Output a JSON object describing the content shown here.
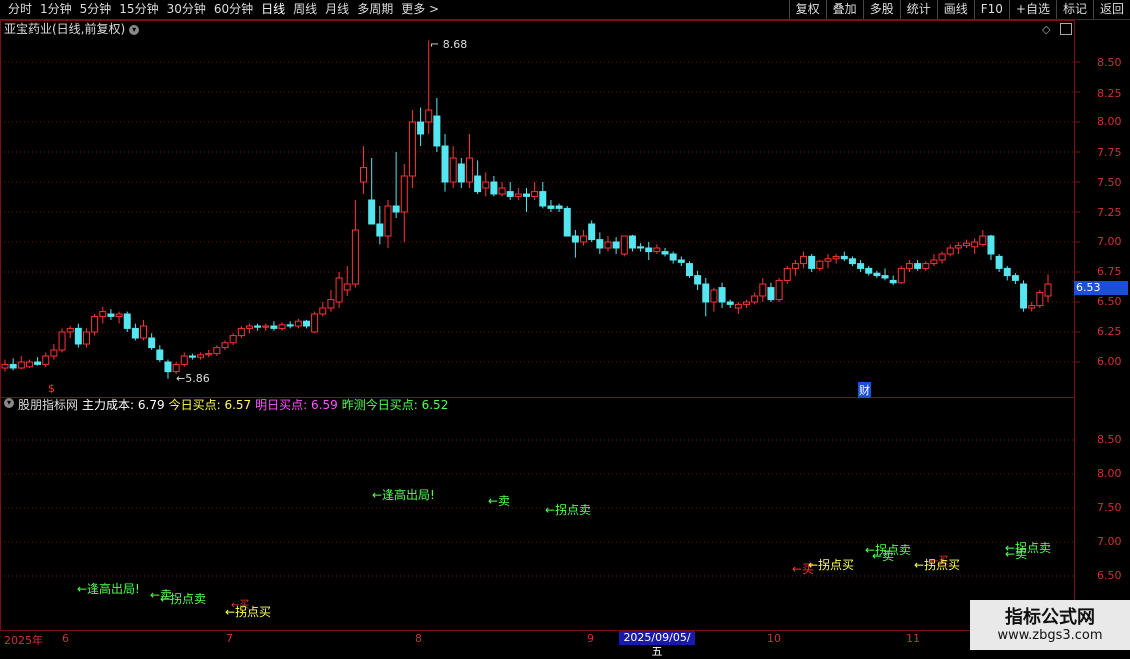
{
  "toolbar": {
    "periods": [
      "分时",
      "1分钟",
      "5分钟",
      "15分钟",
      "30分钟",
      "60分钟",
      "日线",
      "周线",
      "月线",
      "多周期",
      "更多 >"
    ],
    "active_period": "日线",
    "buttons": [
      "复权",
      "叠加",
      "多股",
      "统计",
      "画线",
      "F10",
      "+自选",
      "标记",
      "返回"
    ]
  },
  "main": {
    "title": "亚宝药业(日线,前复权)",
    "icons": [
      "diamond-icon",
      "restore-icon"
    ],
    "price_axis": [
      "8.50",
      "8.25",
      "8.00",
      "7.75",
      "7.50",
      "7.25",
      "7.00",
      "6.75",
      "6.50",
      "6.25",
      "6.00"
    ],
    "current_price": "6.53",
    "high_label": "8.68",
    "low_label": "5.86",
    "marker_dollar": "$",
    "marker_cai": "财"
  },
  "sub": {
    "name": "股朋指标网",
    "items": [
      {
        "label": "主力成本: 6.79",
        "color": "#ffffff"
      },
      {
        "label": "今日买点: 6.57",
        "color": "#ffff55"
      },
      {
        "label": "明日买点: 6.59",
        "color": "#ff55ff"
      },
      {
        "label": "昨测今日买点: 6.52",
        "color": "#55ff55"
      }
    ],
    "axis": [
      "8.50",
      "8.00",
      "7.50",
      "7.00",
      "6.50"
    ],
    "signals": [
      {
        "text": "←逢高出局!",
        "color": "#55ff55"
      },
      {
        "text": "←卖",
        "color": "#55ff55"
      },
      {
        "text": "←拐点卖",
        "color": "#55ff55"
      },
      {
        "text": "←逢高出局!",
        "color": "#55ff55"
      },
      {
        "text": "←卖",
        "color": "#55ff55"
      },
      {
        "text": "←拐点卖",
        "color": "#55ff55"
      },
      {
        "text": "←买",
        "color": "#ff3333"
      },
      {
        "text": "←拐点买",
        "color": "#ffff55"
      },
      {
        "text": "←买",
        "color": "#ff3333"
      },
      {
        "text": "←拐点买",
        "color": "#ffff55"
      },
      {
        "text": "←卖",
        "color": "#55ff55"
      },
      {
        "text": "←拐点卖",
        "color": "#55ff55"
      },
      {
        "text": "←买",
        "color": "#ff3333"
      },
      {
        "text": "←拐点买",
        "color": "#ffff55"
      },
      {
        "text": "←卖",
        "color": "#55ff55"
      },
      {
        "text": "←拐点卖",
        "color": "#55ff55"
      }
    ]
  },
  "dates": [
    "2025年",
    "6",
    "7",
    "8",
    "9",
    "10",
    "11"
  ],
  "date_cursor": "2025/09/05/五",
  "watermark": {
    "title": "指标公式网",
    "url": "www.zbgs3.com"
  },
  "colors": {
    "up": "#ff3333",
    "down": "#55e6f0",
    "grid": "#7a1010",
    "axis_text": "#cc3333"
  },
  "chart_data": {
    "type": "candlestick",
    "x_months": [
      "6",
      "7",
      "8",
      "9",
      "10",
      "11"
    ],
    "ylim": [
      5.85,
      8.7
    ],
    "candles": [
      {
        "o": 5.95,
        "h": 6.02,
        "l": 5.92,
        "c": 5.98
      },
      {
        "o": 5.98,
        "h": 6.03,
        "l": 5.93,
        "c": 5.95
      },
      {
        "o": 5.95,
        "h": 6.05,
        "l": 5.94,
        "c": 6.0
      },
      {
        "o": 5.96,
        "h": 6.02,
        "l": 5.95,
        "c": 6.0
      },
      {
        "o": 6.0,
        "h": 6.04,
        "l": 5.97,
        "c": 5.98
      },
      {
        "o": 5.98,
        "h": 6.08,
        "l": 5.96,
        "c": 6.05
      },
      {
        "o": 6.05,
        "h": 6.15,
        "l": 6.02,
        "c": 6.1
      },
      {
        "o": 6.1,
        "h": 6.28,
        "l": 6.08,
        "c": 6.25
      },
      {
        "o": 6.25,
        "h": 6.3,
        "l": 6.2,
        "c": 6.28
      },
      {
        "o": 6.28,
        "h": 6.32,
        "l": 6.12,
        "c": 6.15
      },
      {
        "o": 6.15,
        "h": 6.28,
        "l": 6.12,
        "c": 6.25
      },
      {
        "o": 6.25,
        "h": 6.4,
        "l": 6.22,
        "c": 6.38
      },
      {
        "o": 6.38,
        "h": 6.46,
        "l": 6.32,
        "c": 6.42
      },
      {
        "o": 6.4,
        "h": 6.44,
        "l": 6.35,
        "c": 6.38
      },
      {
        "o": 6.38,
        "h": 6.42,
        "l": 6.32,
        "c": 6.4
      },
      {
        "o": 6.4,
        "h": 6.42,
        "l": 6.25,
        "c": 6.28
      },
      {
        "o": 6.28,
        "h": 6.32,
        "l": 6.18,
        "c": 6.2
      },
      {
        "o": 6.2,
        "h": 6.35,
        "l": 6.18,
        "c": 6.3
      },
      {
        "o": 6.2,
        "h": 6.24,
        "l": 6.1,
        "c": 6.12
      },
      {
        "o": 6.1,
        "h": 6.14,
        "l": 6.0,
        "c": 6.02
      },
      {
        "o": 6.0,
        "h": 6.02,
        "l": 5.86,
        "c": 5.92
      },
      {
        "o": 5.92,
        "h": 6.0,
        "l": 5.9,
        "c": 5.98
      },
      {
        "o": 5.98,
        "h": 6.08,
        "l": 5.96,
        "c": 6.05
      },
      {
        "o": 6.05,
        "h": 6.07,
        "l": 6.02,
        "c": 6.04
      },
      {
        "o": 6.04,
        "h": 6.08,
        "l": 6.02,
        "c": 6.06
      },
      {
        "o": 6.06,
        "h": 6.1,
        "l": 6.04,
        "c": 6.07
      },
      {
        "o": 6.07,
        "h": 6.14,
        "l": 6.05,
        "c": 6.12
      },
      {
        "o": 6.12,
        "h": 6.18,
        "l": 6.1,
        "c": 6.16
      },
      {
        "o": 6.16,
        "h": 6.24,
        "l": 6.14,
        "c": 6.22
      },
      {
        "o": 6.22,
        "h": 6.3,
        "l": 6.2,
        "c": 6.28
      },
      {
        "o": 6.28,
        "h": 6.32,
        "l": 6.24,
        "c": 6.3
      },
      {
        "o": 6.3,
        "h": 6.32,
        "l": 6.26,
        "c": 6.29
      },
      {
        "o": 6.29,
        "h": 6.32,
        "l": 6.26,
        "c": 6.3
      },
      {
        "o": 6.3,
        "h": 6.34,
        "l": 6.26,
        "c": 6.28
      },
      {
        "o": 6.28,
        "h": 6.33,
        "l": 6.26,
        "c": 6.31
      },
      {
        "o": 6.31,
        "h": 6.34,
        "l": 6.28,
        "c": 6.3
      },
      {
        "o": 6.3,
        "h": 6.36,
        "l": 6.28,
        "c": 6.34
      },
      {
        "o": 6.34,
        "h": 6.35,
        "l": 6.28,
        "c": 6.3
      },
      {
        "o": 6.25,
        "h": 6.42,
        "l": 6.24,
        "c": 6.4
      },
      {
        "o": 6.4,
        "h": 6.5,
        "l": 6.38,
        "c": 6.45
      },
      {
        "o": 6.45,
        "h": 6.6,
        "l": 6.42,
        "c": 6.52
      },
      {
        "o": 6.5,
        "h": 6.75,
        "l": 6.45,
        "c": 6.7
      },
      {
        "o": 6.6,
        "h": 6.8,
        "l": 6.55,
        "c": 6.65
      },
      {
        "o": 6.65,
        "h": 7.35,
        "l": 6.62,
        "c": 7.1
      },
      {
        "o": 7.5,
        "h": 7.8,
        "l": 7.4,
        "c": 7.62
      },
      {
        "o": 7.35,
        "h": 7.7,
        "l": 7.3,
        "c": 7.15
      },
      {
        "o": 7.15,
        "h": 7.3,
        "l": 6.98,
        "c": 7.05
      },
      {
        "o": 7.05,
        "h": 7.35,
        "l": 6.95,
        "c": 7.3
      },
      {
        "o": 7.3,
        "h": 7.75,
        "l": 7.2,
        "c": 7.25
      },
      {
        "o": 7.25,
        "h": 7.65,
        "l": 7.0,
        "c": 7.55
      },
      {
        "o": 7.55,
        "h": 8.1,
        "l": 7.45,
        "c": 8.0
      },
      {
        "o": 8.0,
        "h": 8.12,
        "l": 7.8,
        "c": 7.9
      },
      {
        "o": 8.0,
        "h": 8.68,
        "l": 7.9,
        "c": 8.1
      },
      {
        "o": 8.05,
        "h": 8.2,
        "l": 7.75,
        "c": 7.8
      },
      {
        "o": 7.8,
        "h": 7.9,
        "l": 7.42,
        "c": 7.5
      },
      {
        "o": 7.5,
        "h": 7.8,
        "l": 7.45,
        "c": 7.7
      },
      {
        "o": 7.65,
        "h": 7.7,
        "l": 7.45,
        "c": 7.5
      },
      {
        "o": 7.5,
        "h": 7.9,
        "l": 7.45,
        "c": 7.7
      },
      {
        "o": 7.55,
        "h": 7.68,
        "l": 7.4,
        "c": 7.42
      },
      {
        "o": 7.45,
        "h": 7.58,
        "l": 7.38,
        "c": 7.5
      },
      {
        "o": 7.5,
        "h": 7.55,
        "l": 7.38,
        "c": 7.4
      },
      {
        "o": 7.4,
        "h": 7.5,
        "l": 7.38,
        "c": 7.45
      },
      {
        "o": 7.42,
        "h": 7.5,
        "l": 7.35,
        "c": 7.38
      },
      {
        "o": 7.38,
        "h": 7.45,
        "l": 7.35,
        "c": 7.4
      },
      {
        "o": 7.4,
        "h": 7.45,
        "l": 7.25,
        "c": 7.38
      },
      {
        "o": 7.38,
        "h": 7.5,
        "l": 7.35,
        "c": 7.42
      },
      {
        "o": 7.42,
        "h": 7.5,
        "l": 7.28,
        "c": 7.3
      },
      {
        "o": 7.3,
        "h": 7.35,
        "l": 7.25,
        "c": 7.28
      },
      {
        "o": 7.3,
        "h": 7.32,
        "l": 7.25,
        "c": 7.28
      },
      {
        "o": 7.28,
        "h": 7.3,
        "l": 7.05,
        "c": 7.05
      },
      {
        "o": 7.05,
        "h": 7.1,
        "l": 6.87,
        "c": 7.0
      },
      {
        "o": 7.0,
        "h": 7.1,
        "l": 6.97,
        "c": 7.05
      },
      {
        "o": 7.15,
        "h": 7.18,
        "l": 7.0,
        "c": 7.02
      },
      {
        "o": 7.02,
        "h": 7.08,
        "l": 6.9,
        "c": 6.95
      },
      {
        "o": 6.95,
        "h": 7.05,
        "l": 6.92,
        "c": 7.0
      },
      {
        "o": 7.0,
        "h": 7.04,
        "l": 6.9,
        "c": 6.95
      },
      {
        "o": 6.9,
        "h": 7.05,
        "l": 6.88,
        "c": 7.05
      },
      {
        "o": 7.05,
        "h": 7.06,
        "l": 6.92,
        "c": 6.95
      },
      {
        "o": 6.96,
        "h": 6.99,
        "l": 6.92,
        "c": 6.95
      },
      {
        "o": 6.95,
        "h": 7.0,
        "l": 6.85,
        "c": 6.92
      },
      {
        "o": 6.92,
        "h": 6.98,
        "l": 6.9,
        "c": 6.95
      },
      {
        "o": 6.92,
        "h": 6.95,
        "l": 6.88,
        "c": 6.9
      },
      {
        "o": 6.9,
        "h": 6.92,
        "l": 6.82,
        "c": 6.85
      },
      {
        "o": 6.85,
        "h": 6.88,
        "l": 6.8,
        "c": 6.83
      },
      {
        "o": 6.82,
        "h": 6.84,
        "l": 6.7,
        "c": 6.72
      },
      {
        "o": 6.72,
        "h": 6.76,
        "l": 6.6,
        "c": 6.65
      },
      {
        "o": 6.65,
        "h": 6.7,
        "l": 6.38,
        "c": 6.5
      },
      {
        "o": 6.5,
        "h": 6.62,
        "l": 6.42,
        "c": 6.6
      },
      {
        "o": 6.62,
        "h": 6.66,
        "l": 6.45,
        "c": 6.5
      },
      {
        "o": 6.5,
        "h": 6.52,
        "l": 6.45,
        "c": 6.48
      },
      {
        "o": 6.45,
        "h": 6.5,
        "l": 6.4,
        "c": 6.48
      },
      {
        "o": 6.48,
        "h": 6.52,
        "l": 6.45,
        "c": 6.5
      },
      {
        "o": 6.5,
        "h": 6.58,
        "l": 6.48,
        "c": 6.55
      },
      {
        "o": 6.55,
        "h": 6.7,
        "l": 6.5,
        "c": 6.65
      },
      {
        "o": 6.62,
        "h": 6.66,
        "l": 6.5,
        "c": 6.52
      },
      {
        "o": 6.52,
        "h": 6.7,
        "l": 6.5,
        "c": 6.68
      },
      {
        "o": 6.68,
        "h": 6.8,
        "l": 6.65,
        "c": 6.78
      },
      {
        "o": 6.78,
        "h": 6.85,
        "l": 6.72,
        "c": 6.82
      },
      {
        "o": 6.82,
        "h": 6.92,
        "l": 6.78,
        "c": 6.88
      },
      {
        "o": 6.88,
        "h": 6.9,
        "l": 6.75,
        "c": 6.78
      },
      {
        "o": 6.78,
        "h": 6.85,
        "l": 6.76,
        "c": 6.84
      },
      {
        "o": 6.84,
        "h": 6.9,
        "l": 6.78,
        "c": 6.86
      },
      {
        "o": 6.86,
        "h": 6.9,
        "l": 6.82,
        "c": 6.88
      },
      {
        "o": 6.88,
        "h": 6.92,
        "l": 6.84,
        "c": 6.86
      },
      {
        "o": 6.86,
        "h": 6.88,
        "l": 6.8,
        "c": 6.82
      },
      {
        "o": 6.82,
        "h": 6.85,
        "l": 6.75,
        "c": 6.78
      },
      {
        "o": 6.78,
        "h": 6.8,
        "l": 6.72,
        "c": 6.74
      },
      {
        "o": 6.74,
        "h": 6.76,
        "l": 6.7,
        "c": 6.72
      },
      {
        "o": 6.72,
        "h": 6.78,
        "l": 6.68,
        "c": 6.7
      },
      {
        "o": 6.68,
        "h": 6.72,
        "l": 6.64,
        "c": 6.66
      },
      {
        "o": 6.66,
        "h": 6.8,
        "l": 6.65,
        "c": 6.78
      },
      {
        "o": 6.78,
        "h": 6.85,
        "l": 6.75,
        "c": 6.82
      },
      {
        "o": 6.82,
        "h": 6.85,
        "l": 6.76,
        "c": 6.78
      },
      {
        "o": 6.78,
        "h": 6.84,
        "l": 6.76,
        "c": 6.82
      },
      {
        "o": 6.82,
        "h": 6.9,
        "l": 6.8,
        "c": 6.85
      },
      {
        "o": 6.85,
        "h": 6.92,
        "l": 6.82,
        "c": 6.9
      },
      {
        "o": 6.9,
        "h": 6.98,
        "l": 6.88,
        "c": 6.95
      },
      {
        "o": 6.95,
        "h": 7.0,
        "l": 6.9,
        "c": 6.97
      },
      {
        "o": 6.97,
        "h": 7.02,
        "l": 6.95,
        "c": 6.99
      },
      {
        "o": 6.96,
        "h": 7.03,
        "l": 6.9,
        "c": 7.0
      },
      {
        "o": 6.98,
        "h": 7.1,
        "l": 6.96,
        "c": 7.05
      },
      {
        "o": 7.05,
        "h": 7.06,
        "l": 6.85,
        "c": 6.9
      },
      {
        "o": 6.88,
        "h": 6.9,
        "l": 6.75,
        "c": 6.78
      },
      {
        "o": 6.78,
        "h": 6.8,
        "l": 6.68,
        "c": 6.72
      },
      {
        "o": 6.72,
        "h": 6.74,
        "l": 6.65,
        "c": 6.68
      },
      {
        "o": 6.65,
        "h": 6.68,
        "l": 6.42,
        "c": 6.45
      },
      {
        "o": 6.45,
        "h": 6.5,
        "l": 6.42,
        "c": 6.47
      },
      {
        "o": 6.47,
        "h": 6.6,
        "l": 6.45,
        "c": 6.58
      },
      {
        "o": 6.55,
        "h": 6.73,
        "l": 6.5,
        "c": 6.65
      }
    ]
  }
}
